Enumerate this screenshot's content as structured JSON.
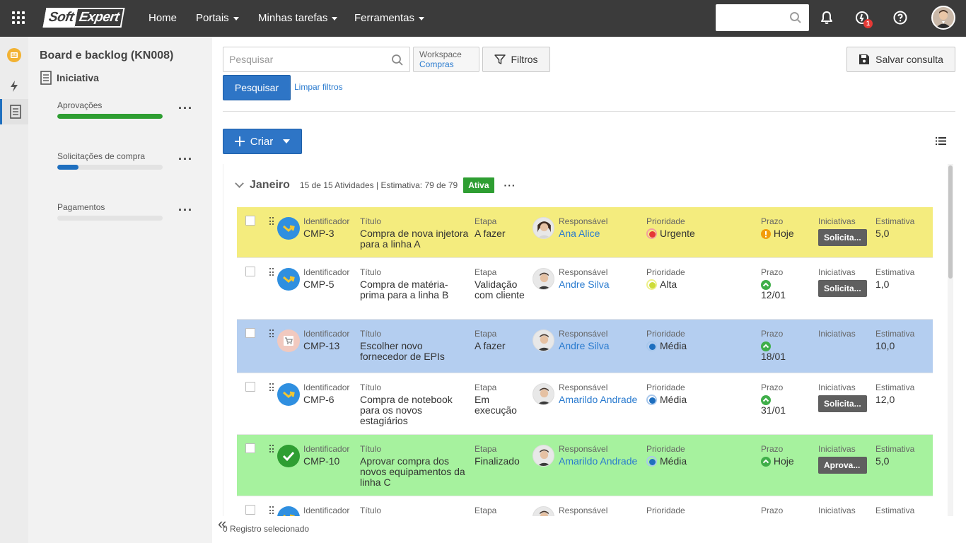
{
  "topbar": {
    "logo_part1": "Soft",
    "logo_part2": "Expert",
    "nav": [
      "Home",
      "Portais",
      "Minhas tarefas",
      "Ferramentas"
    ],
    "notification_badge": "1"
  },
  "side": {
    "title": "Board e backlog (KN008)",
    "subtitle": "Iniciativa",
    "lanes": [
      {
        "label": "Aprovações",
        "progress": 1.0,
        "color": "#2e9e32"
      },
      {
        "label": "Solicitações de compra",
        "progress": 0.2,
        "color": "#1e6fbf"
      },
      {
        "label": "Pagamentos",
        "progress": 0.0,
        "color": "#1e6fbf"
      }
    ]
  },
  "toolbar": {
    "search_placeholder": "Pesquisar",
    "workspace_label": "Workspace",
    "workspace_value": "Compras",
    "filters_label": "Filtros",
    "save_label": "Salvar consulta",
    "search_button": "Pesquisar",
    "clear_filters": "Limpar filtros",
    "create_label": "Criar"
  },
  "group": {
    "name": "Janeiro",
    "info": "15 de 15 Atividades | Estimativa: 79 de 79",
    "status": "Ativa",
    "more": "···"
  },
  "labels": {
    "id": "Identificador",
    "title": "Título",
    "stage": "Etapa",
    "owner": "Responsável",
    "priority": "Prioridade",
    "due": "Prazo",
    "initiatives": "Iniciativas",
    "estimate": "Estimativa"
  },
  "rows": [
    {
      "id": "CMP-3",
      "title": "Compra de nova injetora para a linha A",
      "stage": "A fazer",
      "owner": "Ana Alice",
      "priority": "Urgente",
      "priority_level": "urgente",
      "due": "Hoje",
      "due_icon": "warning-icon",
      "initiative": "Solicita...",
      "estimate": "5,0",
      "bg": "#f4ec7e",
      "type_icon": "arrow-icon"
    },
    {
      "id": "CMP-5",
      "title": "Compra de matéria-prima para a linha B",
      "stage": "Validação com cliente",
      "owner": "Andre Silva",
      "priority": "Alta",
      "priority_level": "alta",
      "due": "12/01",
      "due_icon": "on-time-icon",
      "initiative": "Solicita...",
      "estimate": "1,0",
      "bg": "#ffffff",
      "type_icon": "arrow-icon"
    },
    {
      "id": "CMP-13",
      "title": "Escolher novo fornecedor de EPIs",
      "stage": "A fazer",
      "owner": "Andre Silva",
      "priority": "Média",
      "priority_level": "media",
      "due": "18/01",
      "due_icon": "on-time-icon",
      "initiative": "",
      "estimate": "10,0",
      "bg": "#b4cef0",
      "type_icon": "cart-icon"
    },
    {
      "id": "CMP-6",
      "title": "Compra de notebook para os novos estagiários",
      "stage": "Em execução",
      "owner": "Amarildo Andrade",
      "priority": "Média",
      "priority_level": "media",
      "due": "31/01",
      "due_icon": "on-time-icon",
      "initiative": "Solicita...",
      "estimate": "12,0",
      "bg": "#ffffff",
      "type_icon": "arrow-icon"
    },
    {
      "id": "CMP-10",
      "title": "Aprovar compra dos novos equipamentos da linha C",
      "stage": "Finalizado",
      "owner": "Amarildo Andrade",
      "priority": "Média",
      "priority_level": "media",
      "due": "Hoje",
      "due_icon": "on-time-icon",
      "initiative": "Aprova...",
      "estimate": "5,0",
      "bg": "#a6f29e",
      "type_icon": "check-icon"
    },
    {
      "id": "",
      "title": "",
      "stage": "",
      "owner": "",
      "priority": "",
      "priority_level": "",
      "due": "",
      "due_icon": "",
      "initiative": "",
      "estimate": "",
      "bg": "#ffffff",
      "type_icon": "arrow-icon"
    }
  ],
  "footer": {
    "status": "0 Registro selecionado"
  }
}
